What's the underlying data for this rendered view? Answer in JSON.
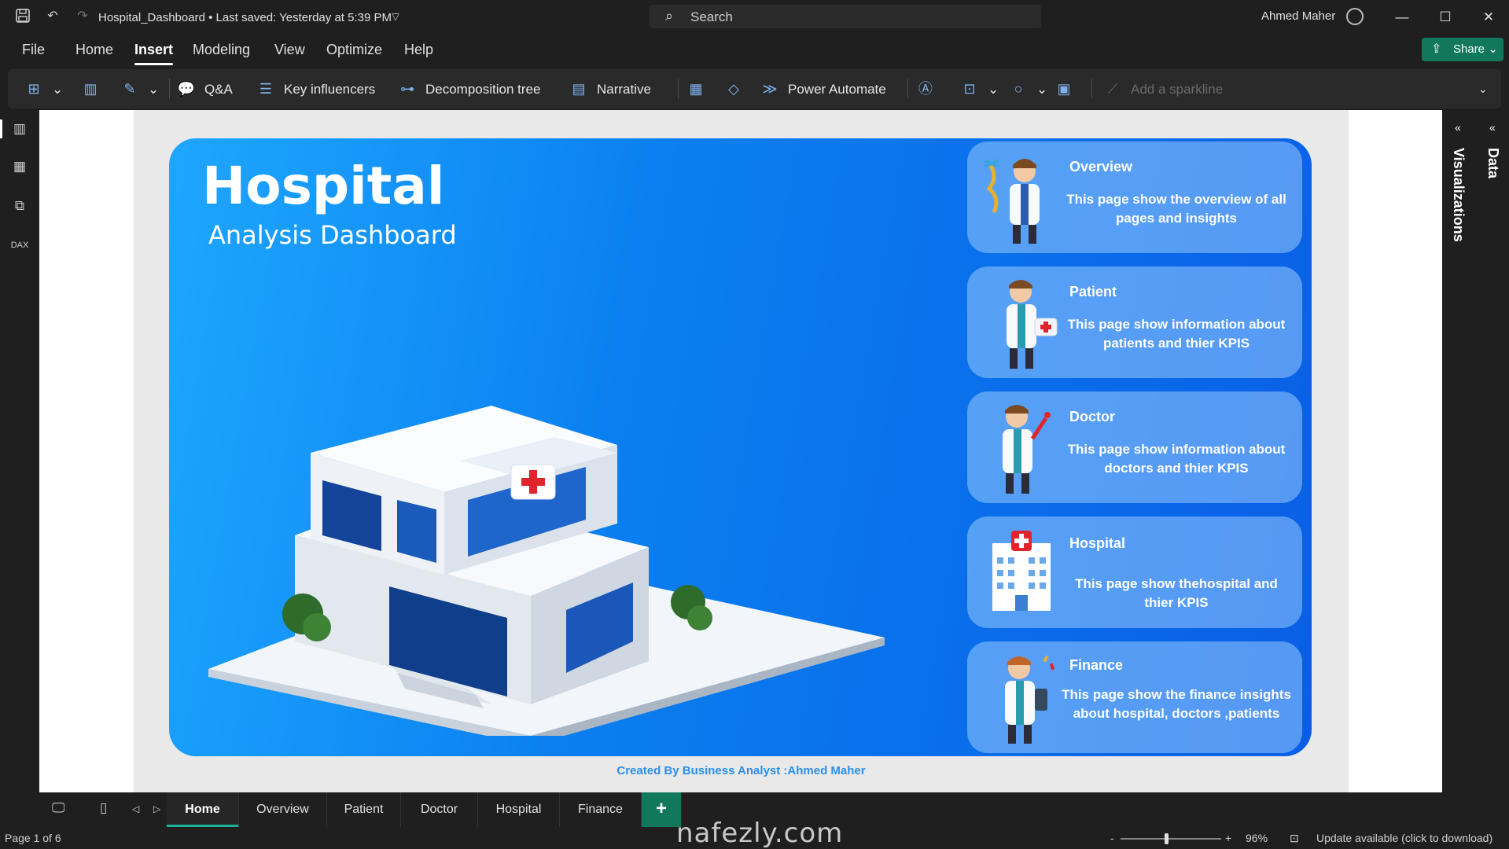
{
  "titlebar": {
    "doc_title": "Hospital_Dashboard • Last saved: Yesterday at 5:39 PM",
    "search_placeholder": "Search",
    "user_name": "Ahmed Maher"
  },
  "menu": {
    "items": [
      "File",
      "Home",
      "Insert",
      "Modeling",
      "View",
      "Optimize",
      "Help"
    ],
    "active": "Insert",
    "share_label": "Share"
  },
  "ribbon": {
    "qa": "Q&A",
    "key_influencers": "Key influencers",
    "decomposition_tree": "Decomposition tree",
    "narrative": "Narrative",
    "power_automate": "Power Automate",
    "add_sparkline": "Add a sparkline"
  },
  "report": {
    "title": "Hospital",
    "subtitle": "Analysis Dashboard",
    "cards": [
      {
        "title": "Overview",
        "desc": "This page show the overview of all pages and insights"
      },
      {
        "title": "Patient",
        "desc": "This page show information about patients and thier KPIS"
      },
      {
        "title": "Doctor",
        "desc": "This page show information about doctors and thier KPIS"
      },
      {
        "title": "Hospital",
        "desc": "This page show thehospital and thier KPIS"
      },
      {
        "title": "Finance",
        "desc": "This page show the finance insights about hospital, doctors ,patients"
      }
    ],
    "credit": "Created By Business Analyst :Ahmed Maher"
  },
  "right_panel": {
    "visualizations": "Visualizations",
    "data": "Data"
  },
  "tabs": {
    "items": [
      "Home",
      "Overview",
      "Patient",
      "Doctor",
      "Hospital",
      "Finance"
    ],
    "active": "Home",
    "add_label": "+"
  },
  "status": {
    "page": "Page 1 of 6",
    "zoom_minus": "-",
    "zoom_plus": "+",
    "zoom": "96%",
    "update": "Update available (click to download)",
    "watermark": "nafezly.com"
  },
  "colors": {
    "accent_green": "#11785c",
    "report_blue": "#0a7ff0",
    "credit_blue": "#2b8fe8"
  }
}
